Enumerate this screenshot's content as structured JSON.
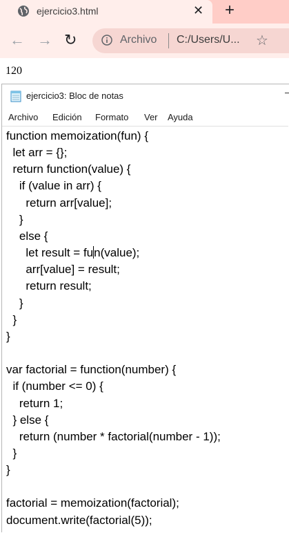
{
  "browser": {
    "tab_title": "ejercicio3.html",
    "tab_close": "✕",
    "new_tab": "+",
    "back": "←",
    "forward": "→",
    "reload": "↻",
    "omnibox_label": "Archivo",
    "url": "C:/Users/U...",
    "star": "☆"
  },
  "page": {
    "output": "120"
  },
  "notepad": {
    "title": "ejercicio3: Bloc de notas",
    "menus": [
      "Archivo",
      "Edición",
      "Formato",
      "Ver",
      "Ayuda"
    ],
    "code_lines": [
      "function memoization(fun) {",
      "  let arr = {};",
      "  return function(value) {",
      "    if (value in arr) {",
      "      return arr[value];",
      "    }",
      "    else {",
      "      let result = fun(value);",
      "      arr[value] = result;",
      "      return result;",
      "    }",
      "  }",
      "}",
      "",
      "var factorial = function(number) {",
      "  if (number <= 0) {",
      "    return 1;",
      "  } else {",
      "    return (number * factorial(number - 1));",
      "  }",
      "}",
      "",
      "factorial = memoization(factorial);",
      "document.write(factorial(5));"
    ]
  },
  "colors": {
    "tab_strip": "#ffcdc7",
    "toolbar": "#ffeeeb",
    "omnibox": "#f6d6d2"
  }
}
